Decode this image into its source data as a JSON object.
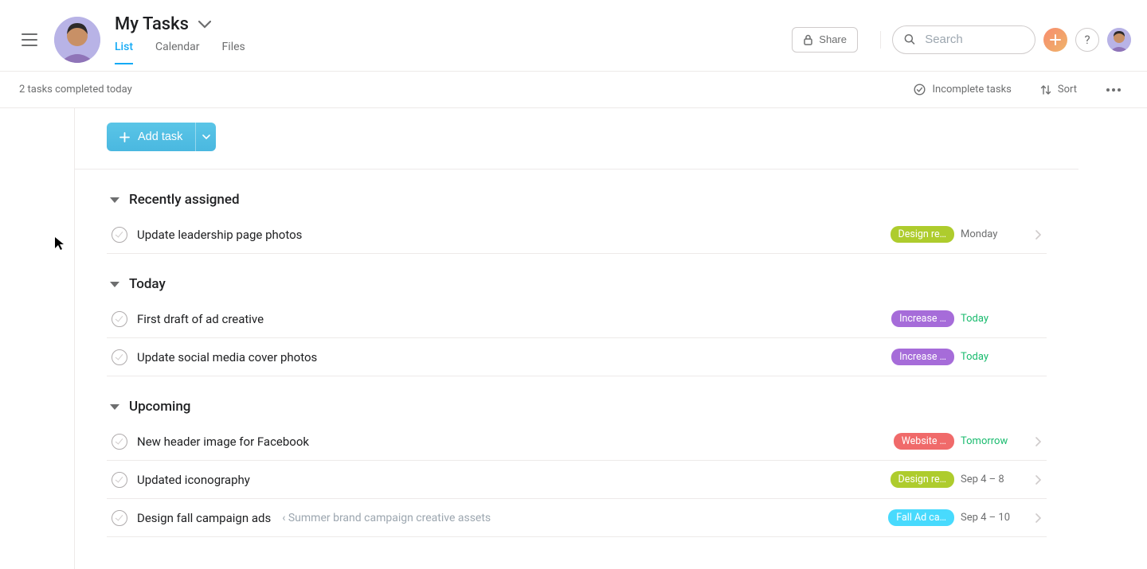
{
  "header": {
    "title": "My Tasks",
    "tabs": [
      "List",
      "Calendar",
      "Files"
    ],
    "active_tab": 0,
    "share_label": "Share",
    "search_placeholder": "Search"
  },
  "subbar": {
    "status_text": "2 tasks completed today",
    "filter_label": "Incomplete tasks",
    "sort_label": "Sort"
  },
  "actions": {
    "add_task_label": "Add task"
  },
  "sections": [
    {
      "name": "Recently assigned",
      "tasks": [
        {
          "title": "Update leadership page photos",
          "tag": "Design re…",
          "tag_color": "#aecc2d",
          "due": "Monday",
          "due_style": "normal",
          "arrow": true
        }
      ]
    },
    {
      "name": "Today",
      "tasks": [
        {
          "title": "First draft of ad creative",
          "tag": "Increase …",
          "tag_color": "#a66cd9",
          "due": "Today",
          "due_style": "upcoming",
          "arrow": false
        },
        {
          "title": "Update social media cover photos",
          "tag": "Increase …",
          "tag_color": "#a66cd9",
          "due": "Today",
          "due_style": "upcoming",
          "arrow": false
        }
      ]
    },
    {
      "name": "Upcoming",
      "tasks": [
        {
          "title": "New header image for Facebook",
          "tag": "Website …",
          "tag_color": "#f06a6a",
          "due": "Tomorrow",
          "due_style": "upcoming",
          "arrow": true
        },
        {
          "title": "Updated iconography",
          "tag": "Design re…",
          "tag_color": "#aecc2d",
          "due": "Sep 4 – 8",
          "due_style": "normal",
          "arrow": true
        },
        {
          "title": "Design fall campaign ads",
          "parent": "‹  Summer brand campaign creative assets",
          "tag": "Fall Ad ca…",
          "tag_color": "#48dafd",
          "due": "Sep 4 – 10",
          "due_style": "normal",
          "arrow": true
        }
      ]
    }
  ]
}
